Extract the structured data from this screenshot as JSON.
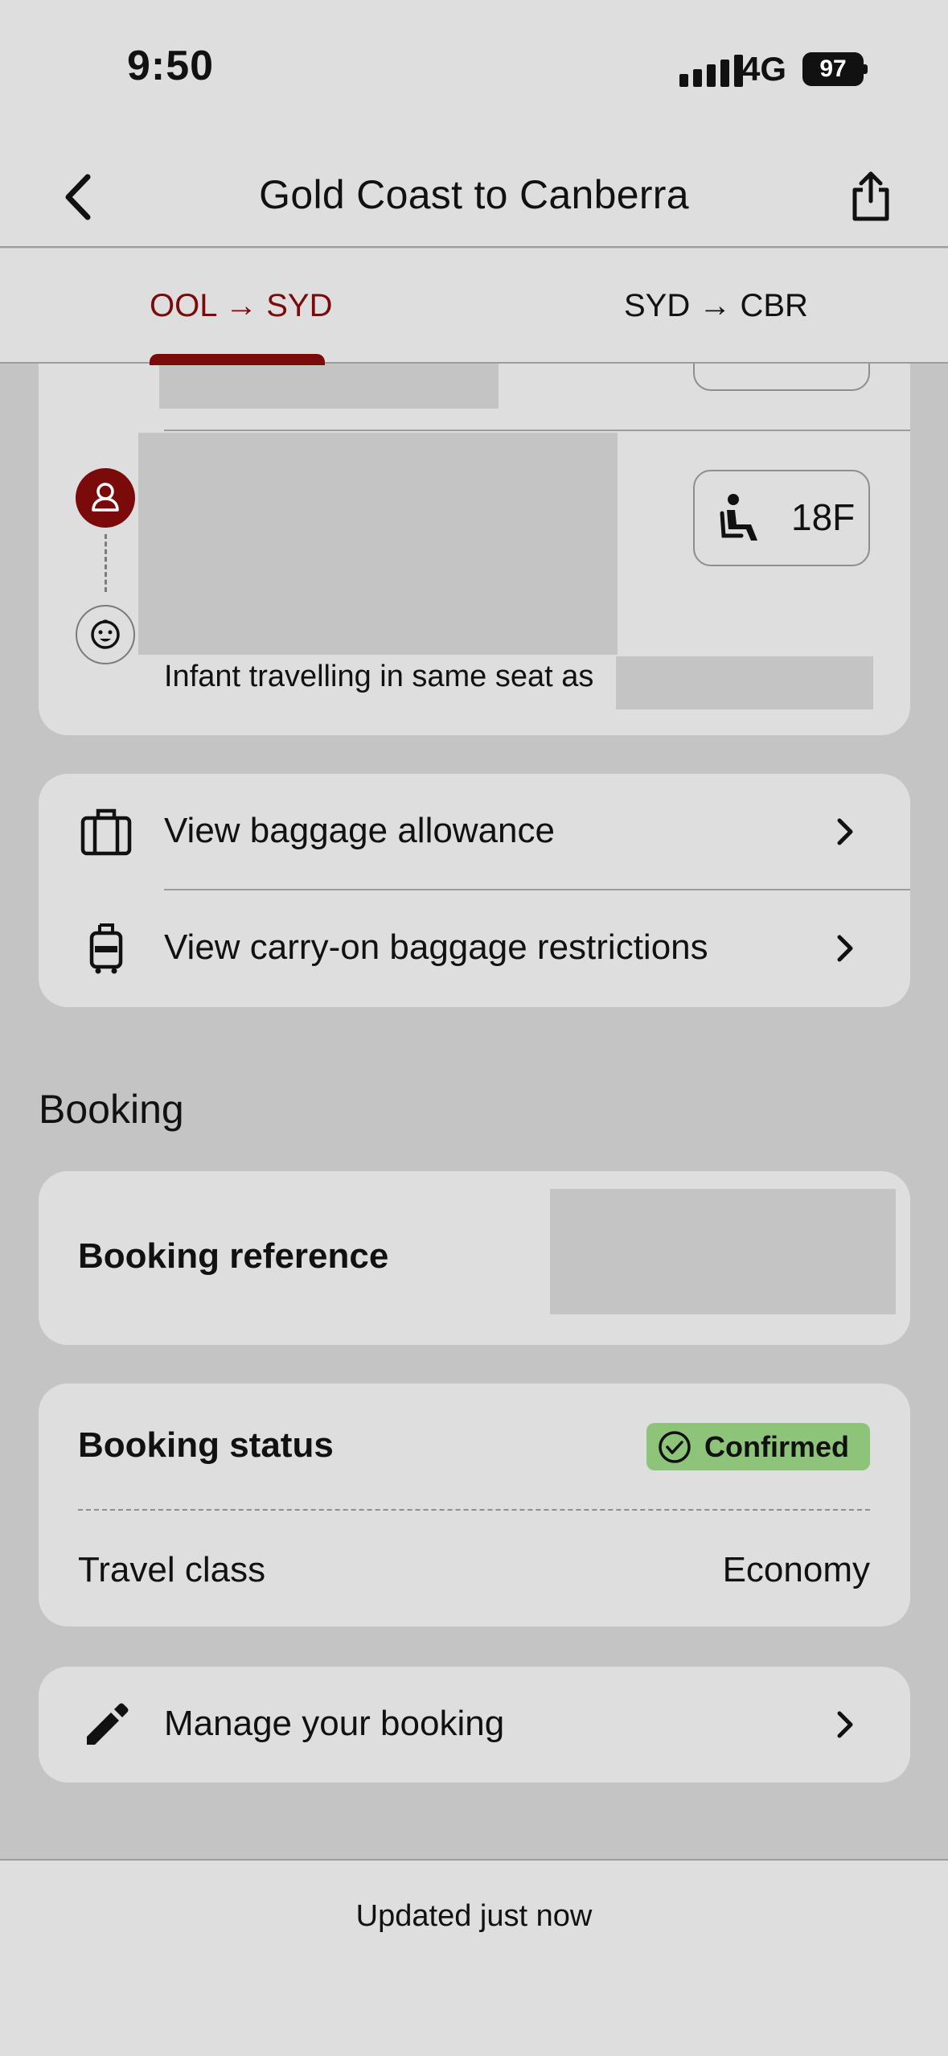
{
  "status_bar": {
    "time": "9:50",
    "network": "4G",
    "battery": "97"
  },
  "nav": {
    "title": "Gold Coast to Canberra"
  },
  "tabs": [
    {
      "label": "OOL → SYD",
      "active": true
    },
    {
      "label": "SYD → CBR",
      "active": false
    }
  ],
  "passengers": {
    "seat": "18F",
    "infant_note": "Infant travelling in same seat as"
  },
  "baggage": {
    "allowance_label": "View baggage allowance",
    "carry_on_label": "View carry-on baggage restrictions"
  },
  "booking": {
    "heading": "Booking",
    "reference_label": "Booking reference",
    "status_label": "Booking status",
    "status_value": "Confirmed",
    "travel_class_label": "Travel class",
    "travel_class_value": "Economy",
    "manage_label": "Manage your booking"
  },
  "footer": {
    "updated": "Updated just now"
  },
  "colors": {
    "accent": "#7b0b0b",
    "confirmed_bg": "#8dc47a",
    "card": "#dedede",
    "background": "#c4c4c4"
  }
}
